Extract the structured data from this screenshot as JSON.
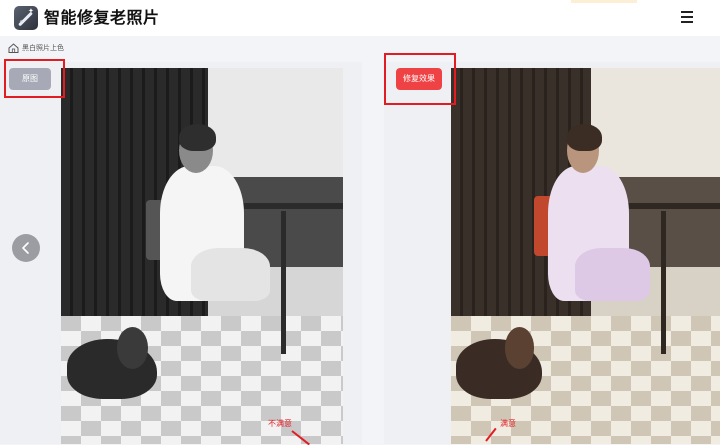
{
  "header": {
    "title": "智能修复老照片",
    "logo_icon": "magic-wand-icon",
    "menu_icon": "hamburger-menu-icon"
  },
  "breadcrumb": {
    "icon": "home-icon",
    "label": "黑白照片上色"
  },
  "compare": {
    "original_label": "原图",
    "restored_label": "修复效果",
    "prev_icon": "chevron-left-icon"
  },
  "annotations": {
    "left_note": "不满意",
    "right_note": "满意"
  },
  "colors": {
    "accent_red": "#ef4244",
    "tag_gray": "#a7aab6",
    "background": "#f3f4f7"
  }
}
